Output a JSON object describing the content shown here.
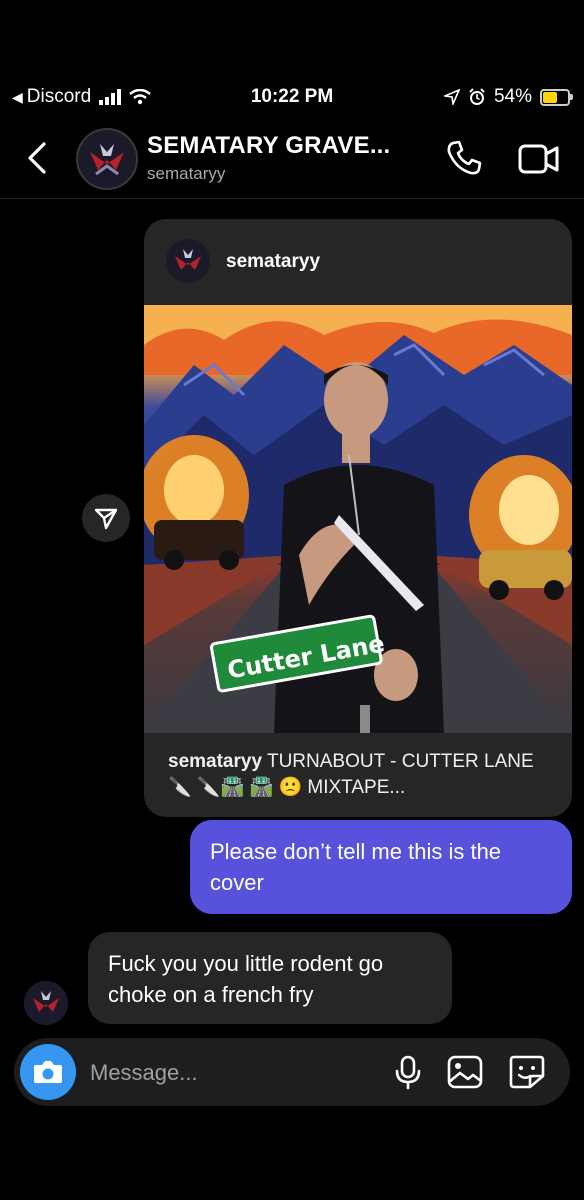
{
  "status_bar": {
    "back_app": "Discord",
    "time": "10:22 PM",
    "battery": "54%",
    "battery_level": 0.54
  },
  "header": {
    "title": "SEMATARY GRAVE...",
    "subtitle": "semataryy"
  },
  "post": {
    "username": "semataryy",
    "image_sign_text": "Cutter Lane",
    "caption_user": "semataryy",
    "caption_text": "TURNABOUT - CUTTER LANE 🔪 🔪🛣️ 🛣️ 🙁 MIXTAPE..."
  },
  "messages": [
    {
      "direction": "sent",
      "text": "Please don’t tell me this is the cover"
    },
    {
      "direction": "received",
      "text": "Fuck you you little rodent go choke on a french fry"
    }
  ],
  "composer": {
    "placeholder": "Message..."
  },
  "colors": {
    "sent_bubble": "#5851db",
    "received_bubble": "#262626",
    "camera_button": "#3797f0",
    "battery_fill": "#ffd60a"
  },
  "icons": [
    "chevron-left-icon",
    "phone-icon",
    "video-camera-icon",
    "share-icon",
    "camera-icon",
    "microphone-icon",
    "gallery-icon",
    "sticker-icon"
  ]
}
